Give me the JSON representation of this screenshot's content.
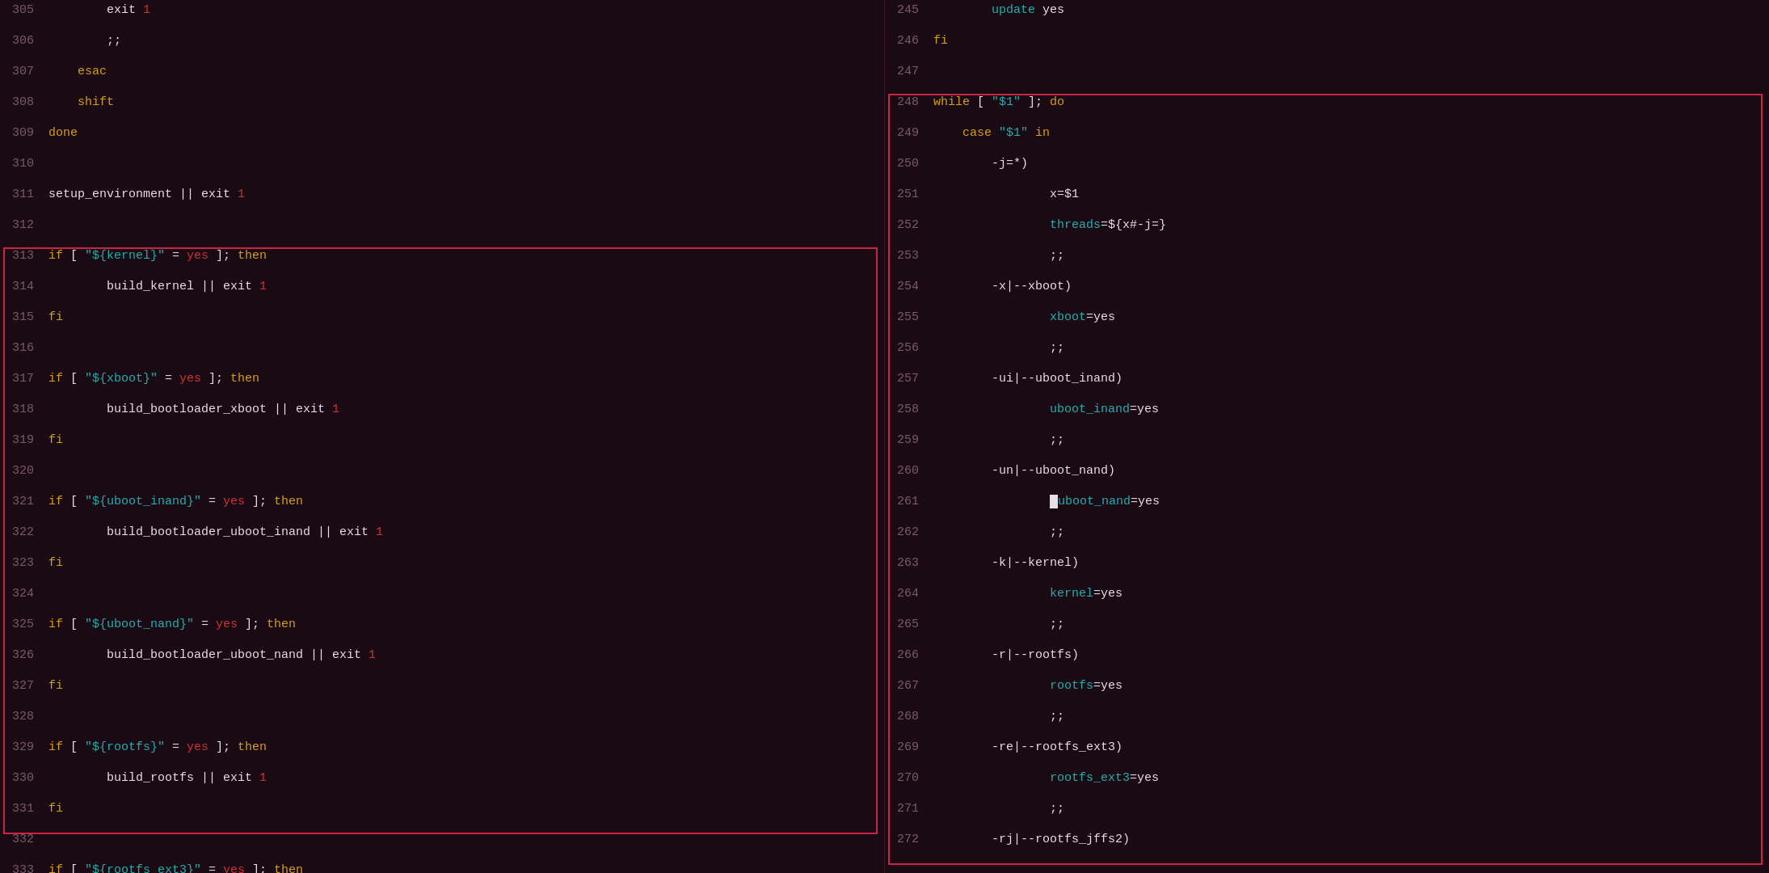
{
  "left_pane": {
    "lines": [
      {
        "num": "305",
        "tokens": [
          {
            "text": "        exit ",
            "cls": "c-white"
          },
          {
            "text": "1",
            "cls": "c-red"
          }
        ]
      },
      {
        "num": "306",
        "tokens": [
          {
            "text": "        ;;",
            "cls": "c-white"
          }
        ]
      },
      {
        "num": "307",
        "tokens": [
          {
            "text": "    esac",
            "cls": "c-yellow"
          }
        ]
      },
      {
        "num": "308",
        "tokens": [
          {
            "text": "    shift",
            "cls": "c-yellow"
          }
        ]
      },
      {
        "num": "309",
        "tokens": [
          {
            "text": "done",
            "cls": "c-yellow"
          }
        ]
      },
      {
        "num": "310",
        "tokens": []
      },
      {
        "num": "311",
        "tokens": [
          {
            "text": "setup_environment ",
            "cls": "c-white"
          },
          {
            "text": "|| ",
            "cls": "c-white"
          },
          {
            "text": "exit ",
            "cls": "c-white"
          },
          {
            "text": "1",
            "cls": "c-red"
          }
        ]
      },
      {
        "num": "312",
        "tokens": []
      },
      {
        "num": "313",
        "tokens": [
          {
            "text": "if ",
            "cls": "c-yellow"
          },
          {
            "text": "[ ",
            "cls": "c-white"
          },
          {
            "text": "\"${kernel}\"",
            "cls": "c-teal"
          },
          {
            "text": " = ",
            "cls": "c-white"
          },
          {
            "text": "yes",
            "cls": "c-red"
          },
          {
            "text": " ]; ",
            "cls": "c-white"
          },
          {
            "text": "then",
            "cls": "c-yellow"
          }
        ],
        "boxed": true
      },
      {
        "num": "314",
        "tokens": [
          {
            "text": "        build_kernel ",
            "cls": "c-white"
          },
          {
            "text": "|| ",
            "cls": "c-white"
          },
          {
            "text": "exit ",
            "cls": "c-white"
          },
          {
            "text": "1",
            "cls": "c-red"
          }
        ],
        "boxed": true
      },
      {
        "num": "315",
        "tokens": [
          {
            "text": "fi",
            "cls": "c-yellow"
          }
        ],
        "boxed": true
      },
      {
        "num": "316",
        "tokens": [],
        "boxed": true
      },
      {
        "num": "317",
        "tokens": [
          {
            "text": "if ",
            "cls": "c-yellow"
          },
          {
            "text": "[ ",
            "cls": "c-white"
          },
          {
            "text": "\"${xboot}\"",
            "cls": "c-teal"
          },
          {
            "text": " = ",
            "cls": "c-white"
          },
          {
            "text": "yes",
            "cls": "c-red"
          },
          {
            "text": " ]; ",
            "cls": "c-white"
          },
          {
            "text": "then",
            "cls": "c-yellow"
          }
        ],
        "boxed": true
      },
      {
        "num": "318",
        "tokens": [
          {
            "text": "        build_bootloader_xboot ",
            "cls": "c-white"
          },
          {
            "text": "|| ",
            "cls": "c-white"
          },
          {
            "text": "exit ",
            "cls": "c-white"
          },
          {
            "text": "1",
            "cls": "c-red"
          }
        ],
        "boxed": true
      },
      {
        "num": "319",
        "tokens": [
          {
            "text": "fi",
            "cls": "c-yellow"
          }
        ],
        "boxed": true
      },
      {
        "num": "320",
        "tokens": [],
        "boxed": true
      },
      {
        "num": "321",
        "tokens": [
          {
            "text": "if ",
            "cls": "c-yellow"
          },
          {
            "text": "[ ",
            "cls": "c-white"
          },
          {
            "text": "\"${uboot_inand}\"",
            "cls": "c-teal"
          },
          {
            "text": " = ",
            "cls": "c-white"
          },
          {
            "text": "yes",
            "cls": "c-red"
          },
          {
            "text": " ]; ",
            "cls": "c-white"
          },
          {
            "text": "then",
            "cls": "c-yellow"
          }
        ],
        "boxed": true
      },
      {
        "num": "322",
        "tokens": [
          {
            "text": "        build_bootloader_uboot_inand ",
            "cls": "c-white"
          },
          {
            "text": "|| ",
            "cls": "c-white"
          },
          {
            "text": "exit ",
            "cls": "c-white"
          },
          {
            "text": "1",
            "cls": "c-red"
          }
        ],
        "boxed": true
      },
      {
        "num": "323",
        "tokens": [
          {
            "text": "fi",
            "cls": "c-yellow"
          }
        ],
        "boxed": true
      },
      {
        "num": "324",
        "tokens": [],
        "boxed": true
      },
      {
        "num": "325",
        "tokens": [
          {
            "text": "if ",
            "cls": "c-yellow"
          },
          {
            "text": "[ ",
            "cls": "c-white"
          },
          {
            "text": "\"${uboot_nand}\"",
            "cls": "c-teal"
          },
          {
            "text": " = ",
            "cls": "c-white"
          },
          {
            "text": "yes",
            "cls": "c-red"
          },
          {
            "text": " ]; ",
            "cls": "c-white"
          },
          {
            "text": "then",
            "cls": "c-yellow"
          }
        ],
        "boxed": true
      },
      {
        "num": "326",
        "tokens": [
          {
            "text": "        build_bootloader_uboot_nand ",
            "cls": "c-white"
          },
          {
            "text": "|| ",
            "cls": "c-white"
          },
          {
            "text": "exit ",
            "cls": "c-white"
          },
          {
            "text": "1",
            "cls": "c-red"
          }
        ],
        "boxed": true
      },
      {
        "num": "327",
        "tokens": [
          {
            "text": "fi",
            "cls": "c-yellow"
          }
        ],
        "boxed": true
      },
      {
        "num": "328",
        "tokens": [],
        "boxed": true
      },
      {
        "num": "329",
        "tokens": [
          {
            "text": "if ",
            "cls": "c-yellow"
          },
          {
            "text": "[ ",
            "cls": "c-white"
          },
          {
            "text": "\"${rootfs}\"",
            "cls": "c-teal"
          },
          {
            "text": " = ",
            "cls": "c-white"
          },
          {
            "text": "yes",
            "cls": "c-red"
          },
          {
            "text": " ]; ",
            "cls": "c-white"
          },
          {
            "text": "then",
            "cls": "c-yellow"
          }
        ],
        "boxed": true
      },
      {
        "num": "330",
        "tokens": [
          {
            "text": "        build_rootfs ",
            "cls": "c-white"
          },
          {
            "text": "|| ",
            "cls": "c-white"
          },
          {
            "text": "exit ",
            "cls": "c-white"
          },
          {
            "text": "1",
            "cls": "c-red"
          }
        ],
        "boxed": true
      },
      {
        "num": "331",
        "tokens": [
          {
            "text": "fi",
            "cls": "c-yellow"
          }
        ],
        "boxed": true
      },
      {
        "num": "332",
        "tokens": []
      },
      {
        "num": "333",
        "tokens": [
          {
            "text": "if ",
            "cls": "c-yellow"
          },
          {
            "text": "[ ",
            "cls": "c-white"
          },
          {
            "text": "\"${rootfs_ext3}\"",
            "cls": "c-teal"
          },
          {
            "text": " = ",
            "cls": "c-white"
          },
          {
            "text": "yes",
            "cls": "c-red"
          },
          {
            "text": " ]; ",
            "cls": "c-white"
          },
          {
            "text": "then",
            "cls": "c-yellow"
          }
        ]
      }
    ]
  },
  "right_pane": {
    "lines": [
      {
        "num": "245",
        "tokens": [
          {
            "text": "        ",
            "cls": ""
          },
          {
            "text": "update",
            "cls": "c-teal"
          },
          {
            "text": " yes",
            "cls": "c-white"
          }
        ]
      },
      {
        "num": "246",
        "tokens": [
          {
            "text": "fi",
            "cls": "c-yellow"
          }
        ]
      },
      {
        "num": "247",
        "tokens": []
      },
      {
        "num": "248",
        "tokens": [
          {
            "text": "while",
            "cls": "c-yellow"
          },
          {
            "text": " [ ",
            "cls": "c-white"
          },
          {
            "text": "\"$1\"",
            "cls": "c-teal"
          },
          {
            "text": " ]; ",
            "cls": "c-white"
          },
          {
            "text": "do",
            "cls": "c-yellow"
          }
        ],
        "boxed": true
      },
      {
        "num": "249",
        "tokens": [
          {
            "text": "    case ",
            "cls": "c-yellow"
          },
          {
            "text": "\"$1\"",
            "cls": "c-teal"
          },
          {
            "text": " in",
            "cls": "c-yellow"
          }
        ],
        "boxed": true
      },
      {
        "num": "250",
        "tokens": [
          {
            "text": "        ",
            "cls": ""
          },
          {
            "text": "-j=*)",
            "cls": "c-white"
          }
        ],
        "boxed": true
      },
      {
        "num": "251",
        "tokens": [
          {
            "text": "                x=$1",
            "cls": "c-white"
          }
        ],
        "boxed": true
      },
      {
        "num": "252",
        "tokens": [
          {
            "text": "                ",
            "cls": ""
          },
          {
            "text": "threads",
            "cls": "c-teal"
          },
          {
            "text": "=${x#-j=}",
            "cls": "c-white"
          }
        ],
        "boxed": true
      },
      {
        "num": "253",
        "tokens": [
          {
            "text": "                ;;",
            "cls": "c-white"
          }
        ],
        "boxed": true
      },
      {
        "num": "254",
        "tokens": [
          {
            "text": "        -x|--xboot)",
            "cls": "c-white"
          }
        ],
        "boxed": true
      },
      {
        "num": "255",
        "tokens": [
          {
            "text": "                ",
            "cls": ""
          },
          {
            "text": "xboot",
            "cls": "c-teal"
          },
          {
            "text": "=yes",
            "cls": "c-white"
          }
        ],
        "boxed": true
      },
      {
        "num": "256",
        "tokens": [
          {
            "text": "                ;;",
            "cls": "c-white"
          }
        ],
        "boxed": true
      },
      {
        "num": "257",
        "tokens": [
          {
            "text": "        -ui|--uboot_inand)",
            "cls": "c-white"
          }
        ],
        "boxed": true
      },
      {
        "num": "258",
        "tokens": [
          {
            "text": "                ",
            "cls": ""
          },
          {
            "text": "uboot_inand",
            "cls": "c-teal"
          },
          {
            "text": "=yes",
            "cls": "c-white"
          }
        ],
        "boxed": true
      },
      {
        "num": "259",
        "tokens": [
          {
            "text": "                ;;",
            "cls": "c-white"
          }
        ],
        "boxed": true
      },
      {
        "num": "260",
        "tokens": [
          {
            "text": "        -un|--uboot_nand)",
            "cls": "c-white"
          }
        ],
        "boxed": true
      },
      {
        "num": "261",
        "tokens": [
          {
            "text": "                ",
            "cls": ""
          },
          {
            "text": "cursor",
            "cls": "cursor_mark"
          },
          {
            "text": "uboot_nand",
            "cls": "c-teal"
          },
          {
            "text": "=yes",
            "cls": "c-white"
          }
        ],
        "boxed": true
      },
      {
        "num": "262",
        "tokens": [
          {
            "text": "                ;;",
            "cls": "c-white"
          }
        ],
        "boxed": true
      },
      {
        "num": "263",
        "tokens": [
          {
            "text": "        -k|--kernel)",
            "cls": "c-white"
          }
        ],
        "boxed": true
      },
      {
        "num": "264",
        "tokens": [
          {
            "text": "                ",
            "cls": ""
          },
          {
            "text": "kernel",
            "cls": "c-teal"
          },
          {
            "text": "=yes",
            "cls": "c-white"
          }
        ],
        "boxed": true
      },
      {
        "num": "265",
        "tokens": [
          {
            "text": "                ;;",
            "cls": "c-white"
          }
        ],
        "boxed": true
      },
      {
        "num": "266",
        "tokens": [
          {
            "text": "        -r|--rootfs)",
            "cls": "c-white"
          }
        ],
        "boxed": true
      },
      {
        "num": "267",
        "tokens": [
          {
            "text": "                ",
            "cls": ""
          },
          {
            "text": "rootfs",
            "cls": "c-teal"
          },
          {
            "text": "=yes",
            "cls": "c-white"
          }
        ],
        "boxed": true
      },
      {
        "num": "268",
        "tokens": [
          {
            "text": "                ;;",
            "cls": "c-white"
          }
        ],
        "boxed": true
      },
      {
        "num": "269",
        "tokens": [
          {
            "text": "        -re|--rootfs_ext3)",
            "cls": "c-white"
          }
        ],
        "boxed": true
      },
      {
        "num": "270",
        "tokens": [
          {
            "text": "                ",
            "cls": ""
          },
          {
            "text": "rootfs_ext3",
            "cls": "c-teal"
          },
          {
            "text": "=yes",
            "cls": "c-white"
          }
        ],
        "boxed": true
      },
      {
        "num": "271",
        "tokens": [
          {
            "text": "                ;;",
            "cls": "c-white"
          }
        ],
        "boxed": true
      },
      {
        "num": "272",
        "tokens": [
          {
            "text": "        -rj|--rootfs_jffs2)",
            "cls": "c-white"
          }
        ],
        "boxed": true
      }
    ]
  },
  "colors": {
    "background": "#1a0a14",
    "line_num": "#7a5a6a",
    "red_box": "#cc2244"
  }
}
